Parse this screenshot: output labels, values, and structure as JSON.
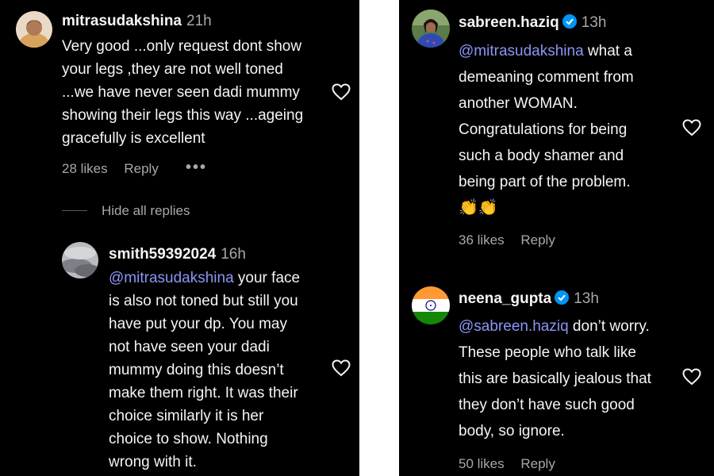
{
  "left": {
    "comment1": {
      "username": "mitrasudakshina",
      "time": "21h",
      "lines": [
        "Very good ...only request dont show",
        "your legs ,they are not well toned",
        "...we have never seen dadi mummy",
        "showing their legs this way ...ageing",
        "gracefully is excellent"
      ],
      "likes": "28 likes",
      "reply": "Reply",
      "more": "•••"
    },
    "hide_replies": "Hide all replies",
    "comment2": {
      "username": "smith59392024",
      "time": "16h",
      "mention": "@mitrasudakshina",
      "first_line_rest": " your face",
      "lines": [
        "is also not toned but still you",
        "have put your dp. You may",
        "not have seen your dadi",
        "mummy doing this doesn’t",
        "make them right. It was their",
        "choice similarly it is her",
        "choice to show. Nothing",
        "wrong with it."
      ]
    }
  },
  "right": {
    "comment1": {
      "username": "sabreen.haziq",
      "time": "13h",
      "mention": "@mitrasudakshina",
      "first_line_rest": " what a",
      "lines": [
        "demeaning comment from",
        "another WOMAN.",
        "Congratulations for being",
        "such a body shamer and",
        "being part of the problem."
      ],
      "emoji": "👏👏",
      "likes": "36 likes",
      "reply": "Reply"
    },
    "comment2": {
      "username": "neena_gupta",
      "time": "13h",
      "mention": "@sabreen.haziq",
      "first_line_rest": " don’t worry.",
      "lines": [
        "These people who talk like",
        "this are basically jealous that",
        "they don’t have such good",
        "body, so ignore."
      ],
      "likes": "50 likes",
      "reply": "Reply"
    }
  },
  "colors": {
    "background": "#000000",
    "text": "#f5f5f5",
    "muted": "#a8a8a8",
    "mention": "#8c95f5",
    "verified": "#0095f6"
  },
  "icons": {
    "like": "heart-outline-icon",
    "verified": "verified-badge-icon",
    "flag": "india-flag-avatar"
  }
}
